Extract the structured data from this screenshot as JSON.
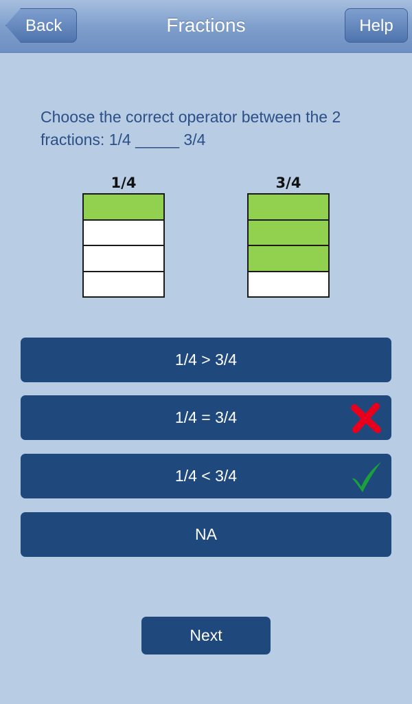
{
  "header": {
    "title": "Fractions",
    "back_label": "Back",
    "help_label": "Help"
  },
  "question": {
    "text": "Choose the correct operator between the 2 fractions: 1/4 _____ 3/4"
  },
  "fractions": [
    {
      "label": "1/4",
      "numerator": 1,
      "denominator": 4
    },
    {
      "label": "3/4",
      "numerator": 3,
      "denominator": 4
    }
  ],
  "options": [
    {
      "label": "1/4 > 3/4",
      "mark": null
    },
    {
      "label": "1/4 = 3/4",
      "mark": "cross-icon"
    },
    {
      "label": "1/4 < 3/4",
      "mark": "check-icon"
    },
    {
      "label": "NA",
      "mark": null
    }
  ],
  "next_label": "Next",
  "colors": {
    "background": "#b8cce4",
    "button": "#1f497d",
    "filled_segment": "#92d050",
    "correct": "#1aa23a",
    "incorrect": "#e8001c"
  }
}
